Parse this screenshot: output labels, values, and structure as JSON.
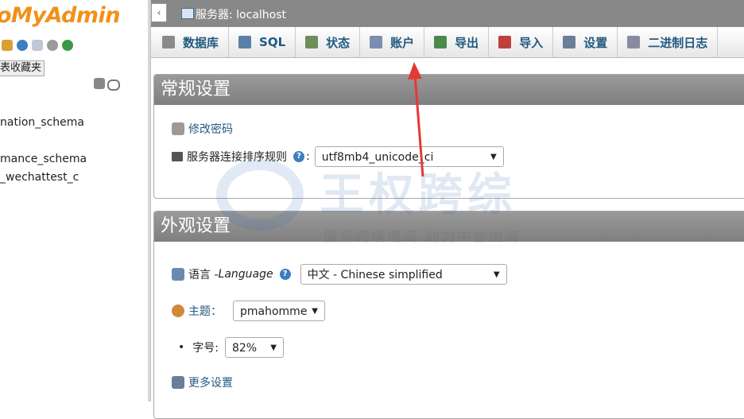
{
  "nav": {
    "logo": "oMyAdmin",
    "favorites_label": "表收藏夹",
    "databases": [
      "nation_schema",
      "mance_schema",
      "_wechattest_c"
    ]
  },
  "serverbar": {
    "collapse_glyph": "‹",
    "title": "服务器: localhost"
  },
  "tabs": [
    {
      "label": "数据库",
      "icon": "database-icon",
      "color": "#8a8a8a"
    },
    {
      "label": "SQL",
      "icon": "sql-icon",
      "color": "#5a7fa8"
    },
    {
      "label": "状态",
      "icon": "status-icon",
      "color": "#6e8e5a"
    },
    {
      "label": "账户",
      "icon": "accounts-icon",
      "color": "#7a8fb0"
    },
    {
      "label": "导出",
      "icon": "export-icon",
      "color": "#4a8a4a"
    },
    {
      "label": "导入",
      "icon": "import-icon",
      "color": "#c04040"
    },
    {
      "label": "设置",
      "icon": "wrench-icon",
      "color": "#6a7d9a"
    },
    {
      "label": "二进制日志",
      "icon": "binlog-icon",
      "color": "#8a8aa0"
    }
  ],
  "general": {
    "title": "常规设置",
    "change_password": "修改密码",
    "collation_label": "服务器连接排序规则",
    "collation_colon": ":",
    "collation_value": "utf8mb4_unicode_ci"
  },
  "appearance": {
    "title": "外观设置",
    "language_label": "语言 - ",
    "language_label_en": "Language",
    "language_value": "中文 - Chinese simplified",
    "theme_label": "主题：",
    "theme_value": "pmahomme",
    "font_label": "字号:",
    "font_value": "82%",
    "more_settings": "更多设置"
  },
  "watermark": {
    "main": "王权跨综",
    "sub": "服务跨境电商 助力中企出海"
  },
  "colors": {
    "accent_link": "#235a81",
    "section_header": "#888888",
    "logo_orange": "#f29019",
    "arrow_red": "#e53935"
  }
}
